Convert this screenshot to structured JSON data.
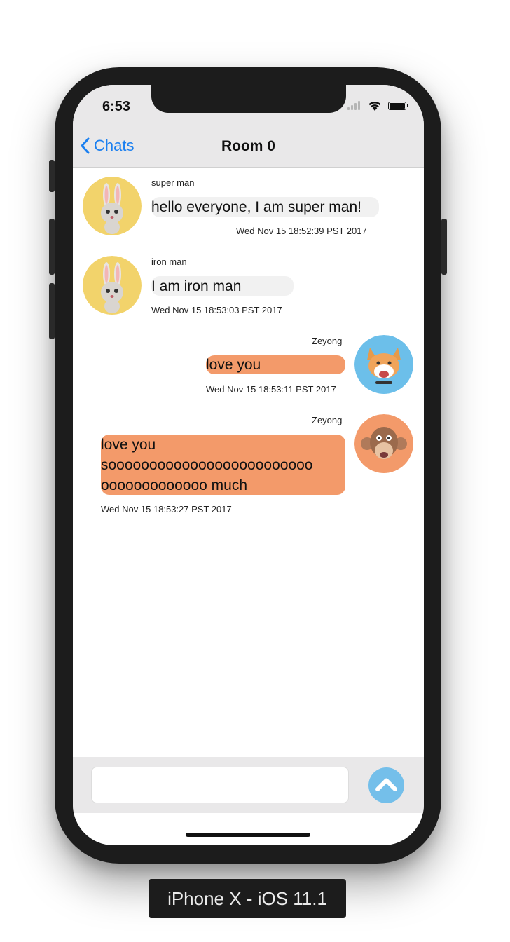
{
  "status_bar": {
    "time": "6:53"
  },
  "nav": {
    "back_label": "Chats",
    "title": "Room 0"
  },
  "messages": [
    {
      "sender": "super man",
      "text": "hello everyone, I am super man!",
      "timestamp": "Wed Nov 15 18:52:39 PST 2017",
      "direction": "incoming",
      "avatar": "rabbit-avatar"
    },
    {
      "sender": "iron man",
      "text": "I am iron man",
      "timestamp": "Wed Nov 15 18:53:03 PST 2017",
      "direction": "incoming",
      "avatar": "rabbit-avatar"
    },
    {
      "sender": "Zeyong",
      "text": "love you",
      "timestamp": "Wed Nov 15 18:53:11 PST 2017",
      "direction": "outgoing",
      "avatar": "dog-avatar"
    },
    {
      "sender": "Zeyong",
      "text": "love you soooooooooooooooooooooooooooooooooooooo much",
      "timestamp": "Wed Nov 15 18:53:27 PST 2017",
      "direction": "outgoing",
      "avatar": "monkey-avatar"
    }
  ],
  "message_lines": {
    "m3_line1": "love you",
    "m3_line2": "sooooooooooooooooooooooooo",
    "m3_line3": "ooooooooooooo much"
  },
  "composer": {
    "value": ""
  },
  "colors": {
    "accent": "#1a7ff0",
    "outgoing_bubble": "#f39a6a",
    "incoming_bubble": "#f1f1f1",
    "send_button": "#74bfea"
  },
  "device_label": "iPhone X - iOS 11.1"
}
